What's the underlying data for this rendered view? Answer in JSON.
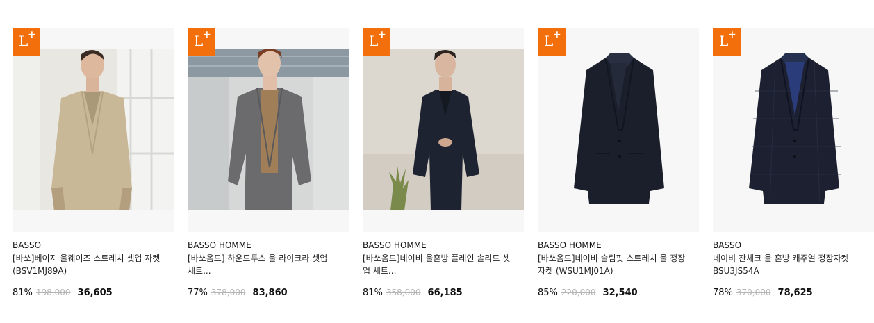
{
  "products": [
    {
      "badge": "L+",
      "brand": "BASSO",
      "name": "[바쏘]베이지 울웨이즈 스트레치 셋업 자켓 (BSV1MJ89A)",
      "discount": "81%",
      "original_price": "198,000",
      "sale_price": "36,605",
      "image": "model-beige-jacket"
    },
    {
      "badge": "L+",
      "brand": "BASSO HOMME",
      "name": "[바쏘옴므] 하운드투스 울 라이크라 셋업 세트...",
      "discount": "77%",
      "original_price": "378,000",
      "sale_price": "83,860",
      "image": "model-grey-houndstooth-suit"
    },
    {
      "badge": "L+",
      "brand": "BASSO HOMME",
      "name": "[바쏘옴므]네이비 울혼방 플레인 솔리드 셋업 세트...",
      "discount": "81%",
      "original_price": "358,000",
      "sale_price": "66,185",
      "image": "model-navy-suit"
    },
    {
      "badge": "L+",
      "brand": "BASSO HOMME",
      "name": "[바쏘옴므]네이비 슬림핏 스트레치 울 정장자켓 (WSU1MJ01A)",
      "discount": "85%",
      "original_price": "220,000",
      "sale_price": "32,540",
      "image": "navy-jacket-ghost"
    },
    {
      "badge": "L+",
      "brand": "BASSO",
      "name": "네이비 잔체크 울 혼방 캐주얼 정장자켓 BSU3JS54A",
      "discount": "78%",
      "original_price": "370,000",
      "sale_price": "78,625",
      "image": "navy-check-jacket-ghost"
    }
  ],
  "colors": {
    "badge": "#f26f0c",
    "strike_price": "#b5b5b5",
    "thumb_bg": "#f7f7f7"
  }
}
